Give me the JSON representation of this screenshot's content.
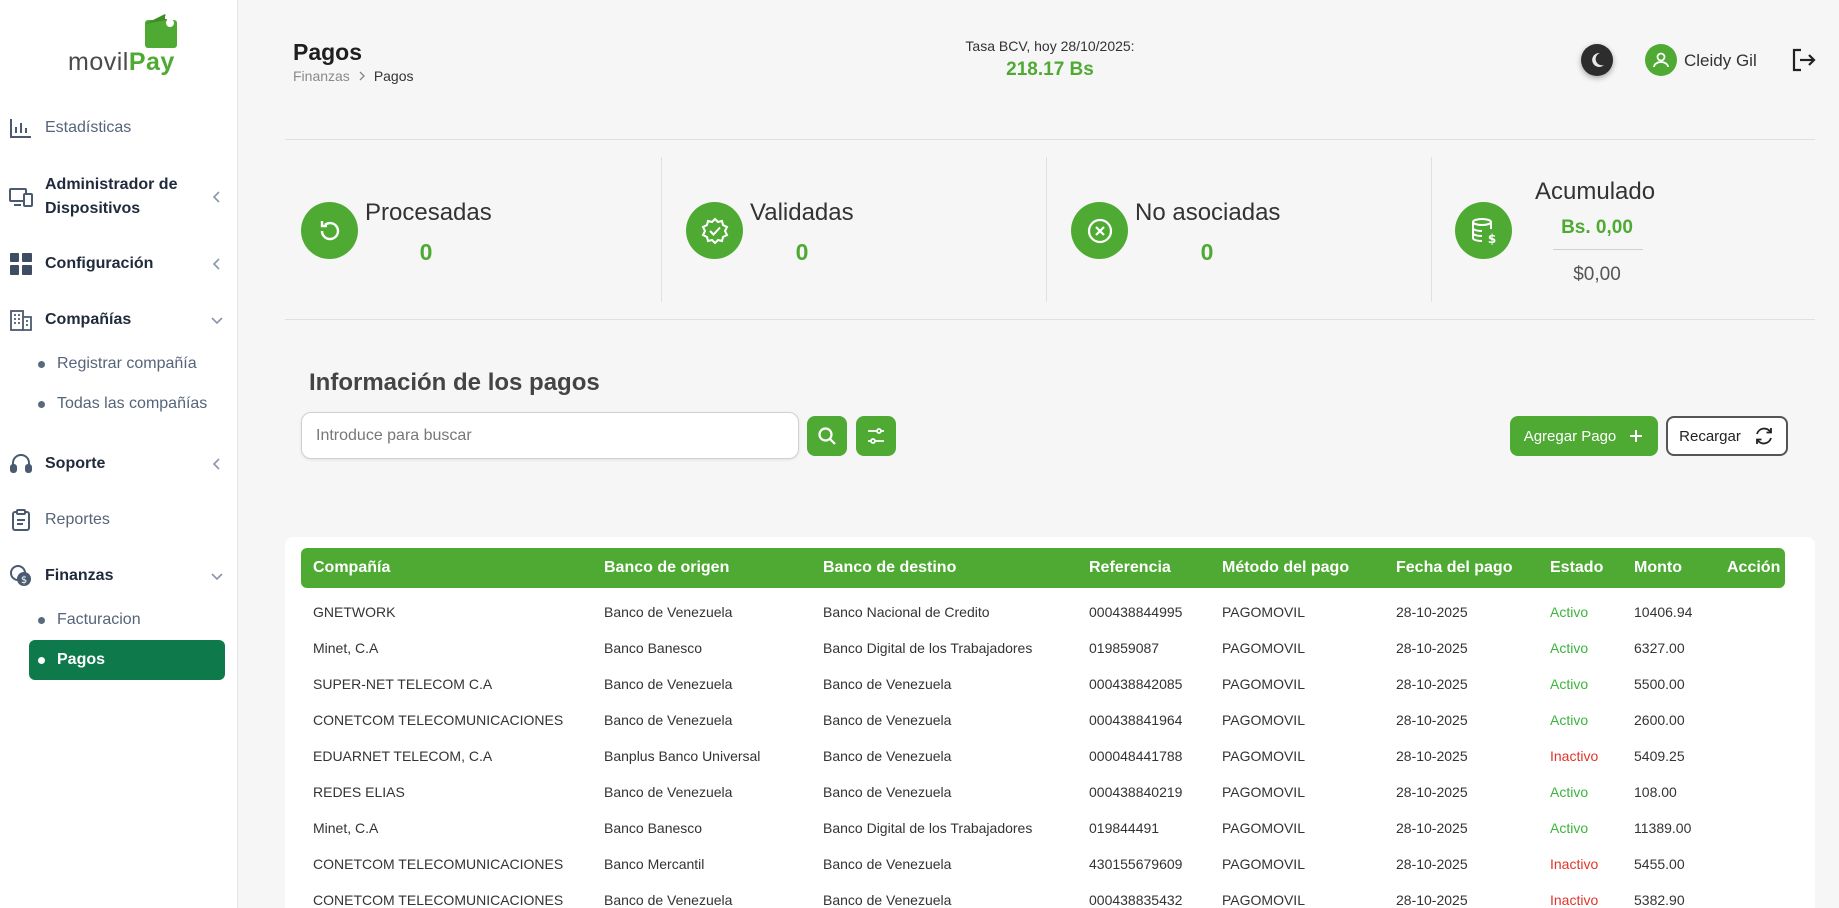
{
  "brand": {
    "part1": "movil",
    "part2": "Pay"
  },
  "sidebar": {
    "items": [
      {
        "label": "Estadísticas"
      },
      {
        "label": "Administrador de",
        "label2": "Dispositivos"
      },
      {
        "label": "Configuración"
      },
      {
        "label": "Compañías"
      },
      {
        "label": "Soporte"
      },
      {
        "label": "Reportes"
      },
      {
        "label": "Finanzas"
      }
    ],
    "companias_sub": [
      "Registrar compañía",
      "Todas las compañías"
    ],
    "finanzas_sub": [
      "Facturacion",
      "Pagos"
    ]
  },
  "header": {
    "title": "Pagos",
    "breadcrumb": [
      "Finanzas",
      "Pagos"
    ],
    "rate_label": "Tasa BCV, hoy 28/10/2025:",
    "rate_value": "218.17 Bs",
    "user_name": "Cleidy Gil"
  },
  "stats": {
    "procesadas": {
      "title": "Procesadas",
      "value": "0"
    },
    "validadas": {
      "title": "Validadas",
      "value": "0"
    },
    "no_asociadas": {
      "title": "No asociadas",
      "value": "0"
    },
    "acumulado": {
      "title": "Acumulado",
      "bs": "Bs. 0,00",
      "usd": "$0,00"
    }
  },
  "payments": {
    "title": "Información de los pagos",
    "search_placeholder": "Introduce para buscar",
    "add_label": "Agregar Pago",
    "reload_label": "Recargar"
  },
  "table": {
    "headers": [
      "Compañía",
      "Banco de origen",
      "Banco de destino",
      "Referencia",
      "Método del pago",
      "Fecha del pago",
      "Estado",
      "Monto",
      "Acción"
    ],
    "rows": [
      [
        "GNETWORK",
        "Banco de Venezuela",
        "Banco Nacional de Credito",
        "000438844995",
        "PAGOMOVIL",
        "28-10-2025",
        "Activo",
        "10406.94"
      ],
      [
        "Minet, C.A",
        "Banco Banesco",
        "Banco Digital de los Trabajadores",
        "019859087",
        "PAGOMOVIL",
        "28-10-2025",
        "Activo",
        "6327.00"
      ],
      [
        "SUPER-NET TELECOM C.A",
        "Banco de Venezuela",
        "Banco de Venezuela",
        "000438842085",
        "PAGOMOVIL",
        "28-10-2025",
        "Activo",
        "5500.00"
      ],
      [
        "CONETCOM TELECOMUNICACIONES",
        "Banco de Venezuela",
        "Banco de Venezuela",
        "000438841964",
        "PAGOMOVIL",
        "28-10-2025",
        "Activo",
        "2600.00"
      ],
      [
        "EDUARNET TELECOM, C.A",
        "Banplus Banco Universal",
        "Banco de Venezuela",
        "000048441788",
        "PAGOMOVIL",
        "28-10-2025",
        "Inactivo",
        "5409.25"
      ],
      [
        "REDES ELIAS",
        "Banco de Venezuela",
        "Banco de Venezuela",
        "000438840219",
        "PAGOMOVIL",
        "28-10-2025",
        "Activo",
        "108.00"
      ],
      [
        "Minet, C.A",
        "Banco Banesco",
        "Banco Digital de los Trabajadores",
        "019844491",
        "PAGOMOVIL",
        "28-10-2025",
        "Activo",
        "11389.00"
      ],
      [
        "CONETCOM TELECOMUNICACIONES",
        "Banco Mercantil",
        "Banco de Venezuela",
        "430155679609",
        "PAGOMOVIL",
        "28-10-2025",
        "Inactivo",
        "5455.00"
      ],
      [
        "CONETCOM TELECOMUNICACIONES",
        "Banco de Venezuela",
        "Banco de Venezuela",
        "000438835432",
        "PAGOMOVIL",
        "28-10-2025",
        "Inactivo",
        "5382.90"
      ]
    ]
  },
  "colors": {
    "brand_green": "#4faa34",
    "active_nav": "#0e7a4c",
    "status_active": "#3db43d",
    "status_inactive": "#e0352b"
  },
  "icons": [
    "chart-icon",
    "devices-icon",
    "grid-icon",
    "building-icon",
    "headset-icon",
    "clipboard-icon",
    "money-icon",
    "moon-icon",
    "user-icon",
    "logout-icon",
    "refresh-icon",
    "check-badge-icon",
    "x-circle-icon",
    "database-dollar-icon",
    "search-icon",
    "filter-icon",
    "plus-icon",
    "reload-icon"
  ]
}
